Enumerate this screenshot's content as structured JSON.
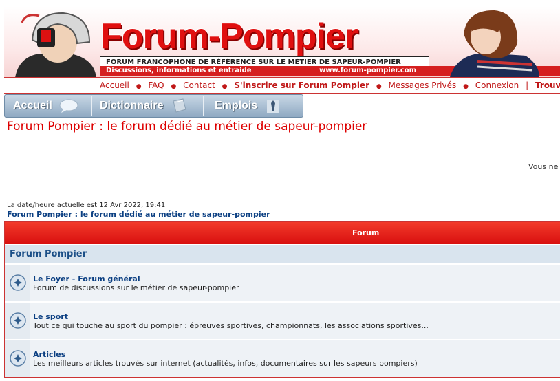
{
  "header": {
    "logo_text": "Forum-Pompier",
    "subtitle": "FORUM FRANCOPHONE DE RÉFÉRENCE SUR LE MÉTIER DE SAPEUR-POMPIER",
    "tagline": "Discussions, informations et entraide",
    "url": "www.forum-pompier.com"
  },
  "toplinks": [
    "Accueil",
    "FAQ",
    "Contact",
    "S'inscrire sur Forum Pompier",
    "Messages Privés",
    "Connexion",
    "Trouver u"
  ],
  "tabs": [
    "Accueil",
    "Dictionnaire",
    "Emplois"
  ],
  "page": {
    "title": "Forum Pompier : le forum dédié au métier de sapeur-pompier",
    "vous": "Vous ne",
    "datetime": "La date/heure actuelle est 12 Avr 2022, 19:41",
    "breadcrumb": "Forum Pompier : le forum dédié au métier de sapeur-pompier"
  },
  "table": {
    "header": "Forum",
    "category": "Forum Pompier",
    "forums": [
      {
        "title": "Le Foyer - Forum général",
        "desc": "Forum de discussions sur le métier de sapeur-pompier"
      },
      {
        "title": "Le sport",
        "desc": "Tout ce qui touche au sport du pompier : épreuves sportives, championnats, les associations sportives..."
      },
      {
        "title": "Articles",
        "desc": "Les meilleurs articles trouvés sur internet (actualités, infos, documentaires sur les sapeurs pompiers)"
      }
    ]
  },
  "colors": {
    "brand_red": "#e01010",
    "link_blue": "#0b3f82",
    "tab_blue": "#8fa9c2"
  }
}
